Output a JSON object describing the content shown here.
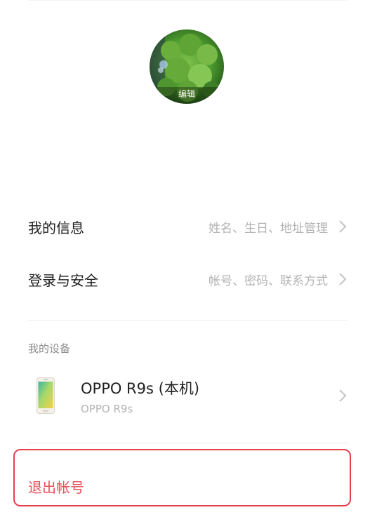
{
  "avatar": {
    "edit_label": "编辑",
    "icon": "moss-photo"
  },
  "account": {
    "rows": [
      {
        "title": "我的信息",
        "hint": "姓名、生日、地址管理",
        "icon": "chevron-right-icon"
      },
      {
        "title": "登录与安全",
        "hint": "帐号、密码、联系方式",
        "icon": "chevron-right-icon"
      }
    ]
  },
  "devices": {
    "section_label": "我的设备",
    "items": [
      {
        "name": "OPPO R9s (本机)",
        "model": "OPPO R9s",
        "icon": "phone-icon"
      }
    ]
  },
  "logout": {
    "label": "退出帐号"
  },
  "colors": {
    "danger": "#e34050",
    "hint_text": "#b3b3b3",
    "section_text": "#8c8c8c"
  }
}
